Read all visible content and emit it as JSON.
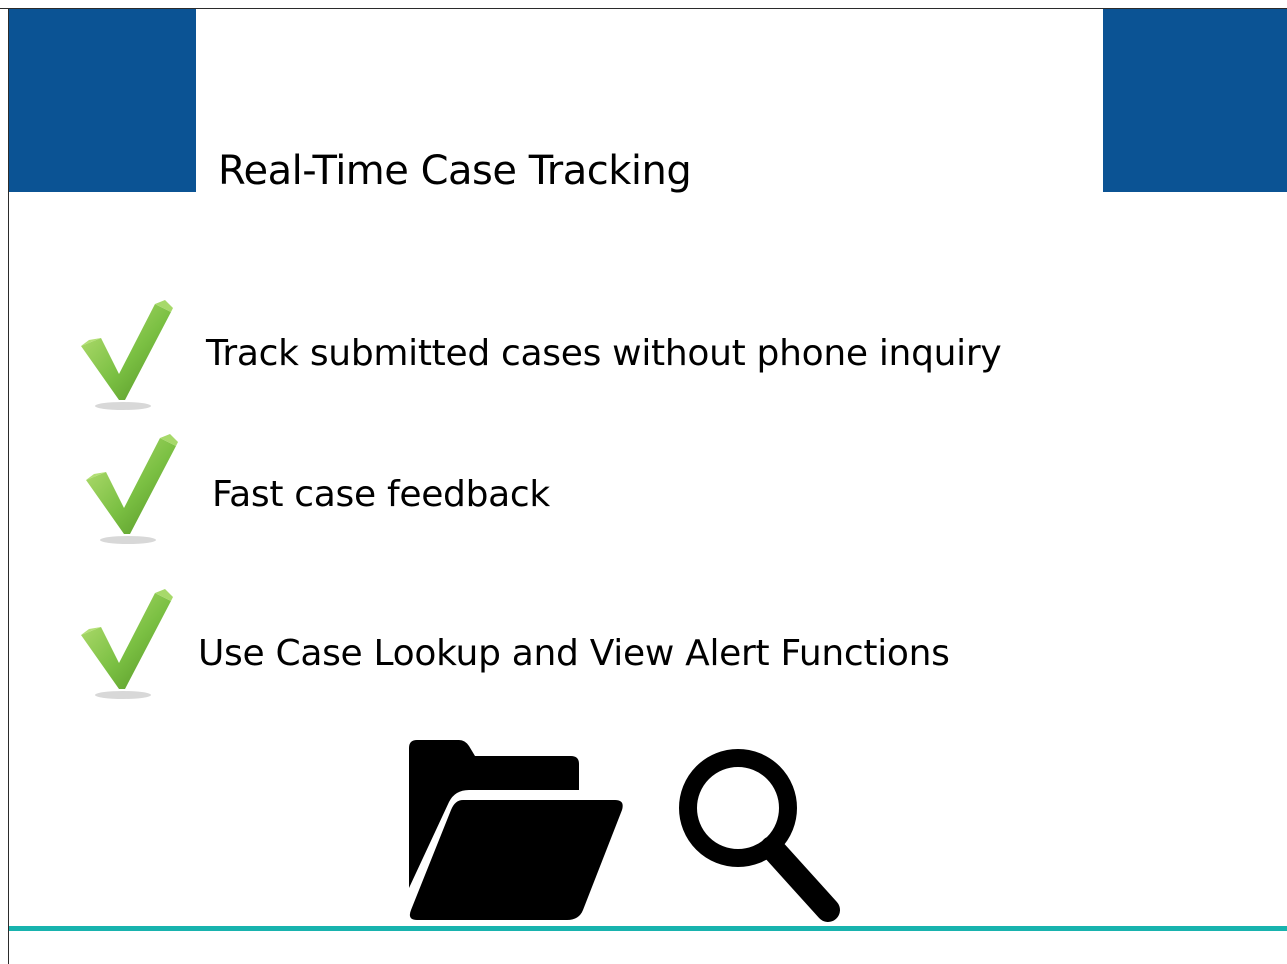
{
  "title": "Real-Time Case Tracking",
  "bullets": [
    {
      "text": "Track submitted cases without phone inquiry",
      "icon": "check-icon"
    },
    {
      "text": "Fast case feedback",
      "icon": "check-icon"
    },
    {
      "text": "Use Case Lookup and View Alert Functions",
      "icon": "check-icon"
    }
  ],
  "icons": [
    "folder-open-icon",
    "magnifying-glass-icon"
  ],
  "colors": {
    "header_block": "#0b5394",
    "bottom_rule": "#18b3ae",
    "check_green": "#7bc043"
  }
}
